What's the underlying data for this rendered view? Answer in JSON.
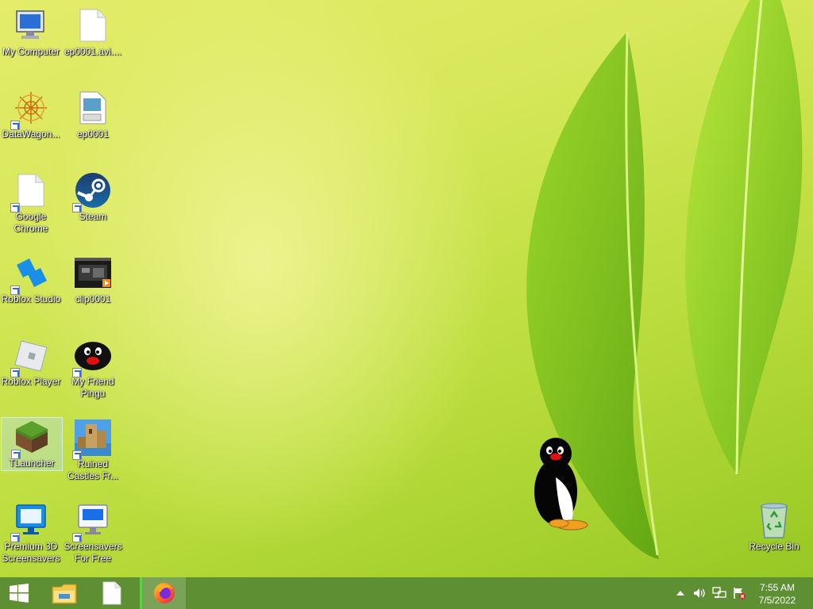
{
  "desktop": {
    "icons": [
      {
        "label": "My Computer"
      },
      {
        "label": "ep0001.avi...."
      },
      {
        "label": "DataWagon..."
      },
      {
        "label": "ep0001"
      },
      {
        "label": "Google Chrome"
      },
      {
        "label": "Steam"
      },
      {
        "label": "Roblox Studio"
      },
      {
        "label": "clip0001"
      },
      {
        "label": "Roblox Player"
      },
      {
        "label": "My Friend Pingu"
      },
      {
        "label": "TLauncher"
      },
      {
        "label": "Ruined Castles Fr..."
      },
      {
        "label": "Premium 3D Screensavers"
      },
      {
        "label": "Screensavers For Free"
      },
      {
        "label": "Recycle Bin"
      }
    ]
  },
  "taskbar": {
    "clock": {
      "time": "7:55 AM",
      "date": "7/5/2022"
    }
  },
  "colors": {
    "taskbar": "#5f8f33",
    "accent": "#2a6fd6"
  }
}
